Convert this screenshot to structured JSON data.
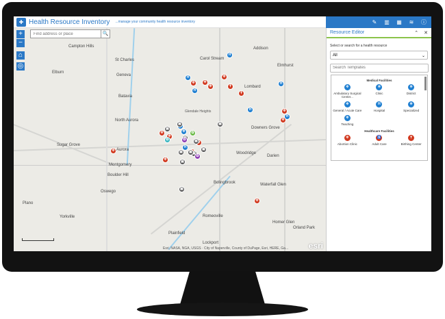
{
  "app": {
    "title": "Health Resource Inventory",
    "subtitle": "...manage your community health resource inventory"
  },
  "toolbar": {
    "items": [
      {
        "icon": "edit-pin-icon",
        "glyph": "✎"
      },
      {
        "icon": "building-icon",
        "glyph": "▥"
      },
      {
        "icon": "grid-icon",
        "glyph": "▦"
      },
      {
        "icon": "layers-icon",
        "glyph": "≋"
      },
      {
        "icon": "info-icon",
        "glyph": "ⓘ"
      }
    ]
  },
  "map": {
    "search_placeholder": "Find address or place",
    "zoom_in": "+",
    "zoom_out": "−",
    "home": "⌂",
    "locate": "◎",
    "attribution": "Esri, NASA, NGA, USGS · City of Naperville, County of DuPage, Esri, HERE, Ga...",
    "logo": "esri",
    "places": [
      "Campton Hills",
      "St Charles",
      "Elburn",
      "Geneva",
      "Batavia",
      "North Aurora",
      "Sugar Grove",
      "Aurora",
      "Montgomery",
      "Boulder Hill",
      "Oswego",
      "Plano",
      "Yorkville",
      "Addison",
      "Carol Stream",
      "Elmhurst",
      "Lombard",
      "Downers Grove",
      "Woodridge",
      "Darien",
      "Bolingbrook",
      "Waterfall Glen",
      "Romeoville",
      "Homer Glen",
      "Orland Park",
      "Lockport",
      "Plainfield",
      "Glendale Heights"
    ],
    "colors": {
      "hospital": "#1f7fd1",
      "healthcare": "#d13a20",
      "other": "#555555",
      "purple": "#8e3fb5",
      "green": "#6dbb4a",
      "teal": "#3fb8c2"
    }
  },
  "panel": {
    "title": "Resource Editor",
    "collapse": "⌃",
    "close": "✕",
    "description": "Select or search for a health resource",
    "filter_value": "All",
    "search_placeholder": "Search Templates",
    "sections": [
      {
        "title": "Medical Facilities",
        "items": [
          {
            "label": "Ambulatory Surgical Center...",
            "glyph": "✲"
          },
          {
            "label": "Clinic",
            "glyph": "✲"
          },
          {
            "label": "District",
            "glyph": "✲"
          },
          {
            "label": "General / Acute Care",
            "glyph": "✲"
          },
          {
            "label": "Hospital",
            "glyph": "H"
          },
          {
            "label": "Specialized",
            "glyph": "✲"
          },
          {
            "label": "Teaching",
            "glyph": "✲"
          }
        ]
      },
      {
        "title": "Healthcare Facilities",
        "items": [
          {
            "label": "Abortion Clinic",
            "glyph": "✲"
          },
          {
            "label": "Adult Care",
            "glyph": "♿"
          },
          {
            "label": "Birthing Center",
            "glyph": "✝"
          }
        ]
      }
    ]
  }
}
